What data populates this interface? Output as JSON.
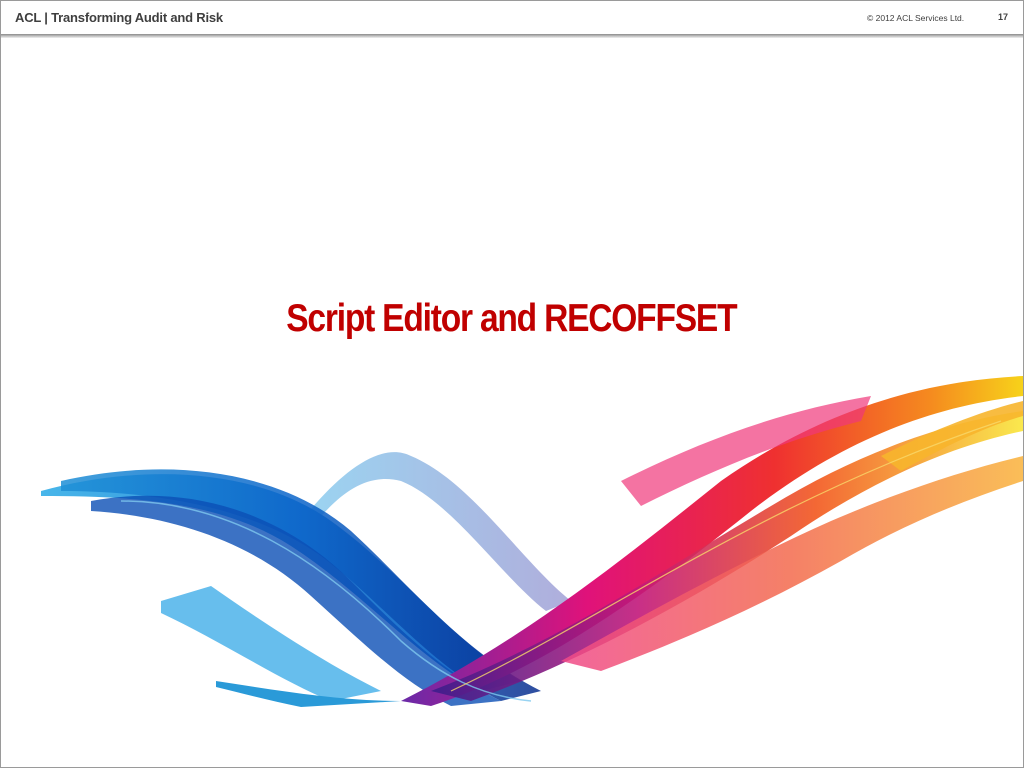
{
  "header": {
    "title": "ACL | Transforming Audit and Risk",
    "copyright": "© 2012 ACL Services Ltd.",
    "page_number": "17"
  },
  "slide": {
    "title": "Script Editor and RECOFFSET"
  },
  "colors": {
    "title": "#c00000",
    "header_text": "#3f3f3f"
  }
}
